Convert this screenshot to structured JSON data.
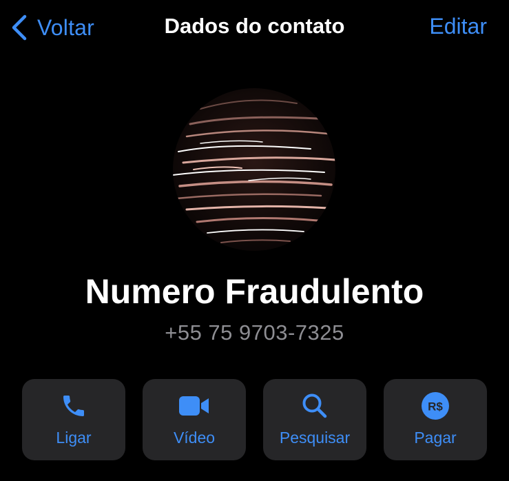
{
  "nav": {
    "back_label": "Voltar",
    "title": "Dados do contato",
    "edit_label": "Editar"
  },
  "contact": {
    "name": "Numero Fraudulento",
    "phone": "+55 75 9703-7325"
  },
  "actions": [
    {
      "label": "Ligar",
      "icon": "phone-icon"
    },
    {
      "label": "Vídeo",
      "icon": "video-icon"
    },
    {
      "label": "Pesquisar",
      "icon": "search-icon"
    },
    {
      "label": "Pagar",
      "icon": "payment-icon",
      "icon_text": "R$"
    }
  ],
  "colors": {
    "accent": "#3e8ef7",
    "background": "#000000",
    "button_background": "#262628",
    "secondary_text": "#8e8e93"
  }
}
